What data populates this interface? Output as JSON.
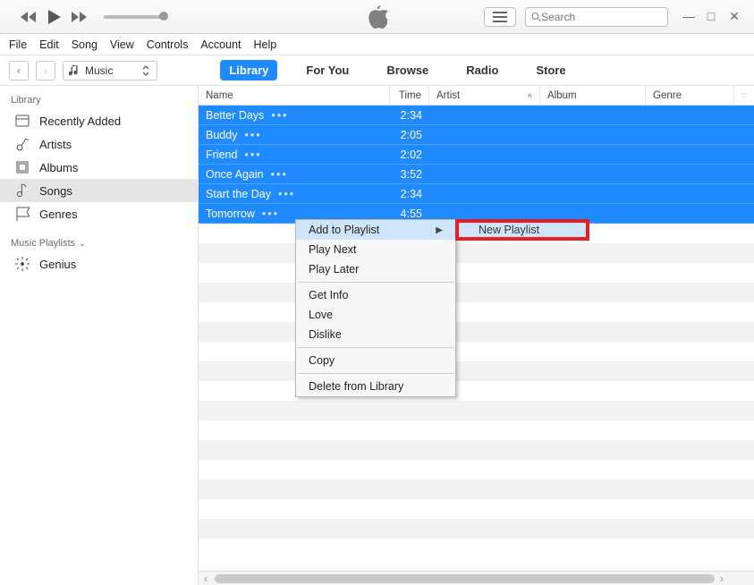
{
  "search": {
    "placeholder": "Search"
  },
  "menus": [
    "File",
    "Edit",
    "Song",
    "View",
    "Controls",
    "Account",
    "Help"
  ],
  "source_selector": {
    "label": "Music"
  },
  "tabs": [
    "Library",
    "For You",
    "Browse",
    "Radio",
    "Store"
  ],
  "active_tab": "Library",
  "sidebar": {
    "library_header": "Library",
    "items": [
      {
        "label": "Recently Added"
      },
      {
        "label": "Artists"
      },
      {
        "label": "Albums"
      },
      {
        "label": "Songs"
      },
      {
        "label": "Genres"
      }
    ],
    "selected": "Songs",
    "playlists_header": "Music Playlists",
    "playlist_items": [
      {
        "label": "Genius"
      }
    ]
  },
  "columns": {
    "name": "Name",
    "time": "Time",
    "artist": "Artist",
    "album": "Album",
    "genre": "Genre"
  },
  "sort": {
    "column": "Artist",
    "dir": "asc"
  },
  "songs": [
    {
      "name": "Better Days",
      "time": "2:34"
    },
    {
      "name": "Buddy",
      "time": "2:05"
    },
    {
      "name": "Friend",
      "time": "2:02"
    },
    {
      "name": "Once Again",
      "time": "3:52"
    },
    {
      "name": "Start the Day",
      "time": "2:34"
    },
    {
      "name": "Tomorrow",
      "time": "4:55"
    }
  ],
  "context_menu": {
    "items": [
      {
        "label": "Add to Playlist",
        "submenu": true,
        "hover": true
      },
      {
        "label": "Play Next"
      },
      {
        "label": "Play Later"
      },
      {
        "sep": true
      },
      {
        "label": "Get Info"
      },
      {
        "label": "Love"
      },
      {
        "label": "Dislike"
      },
      {
        "sep": true
      },
      {
        "label": "Copy"
      },
      {
        "sep": true
      },
      {
        "label": "Delete from Library"
      }
    ],
    "submenu": {
      "label": "New Playlist"
    }
  }
}
